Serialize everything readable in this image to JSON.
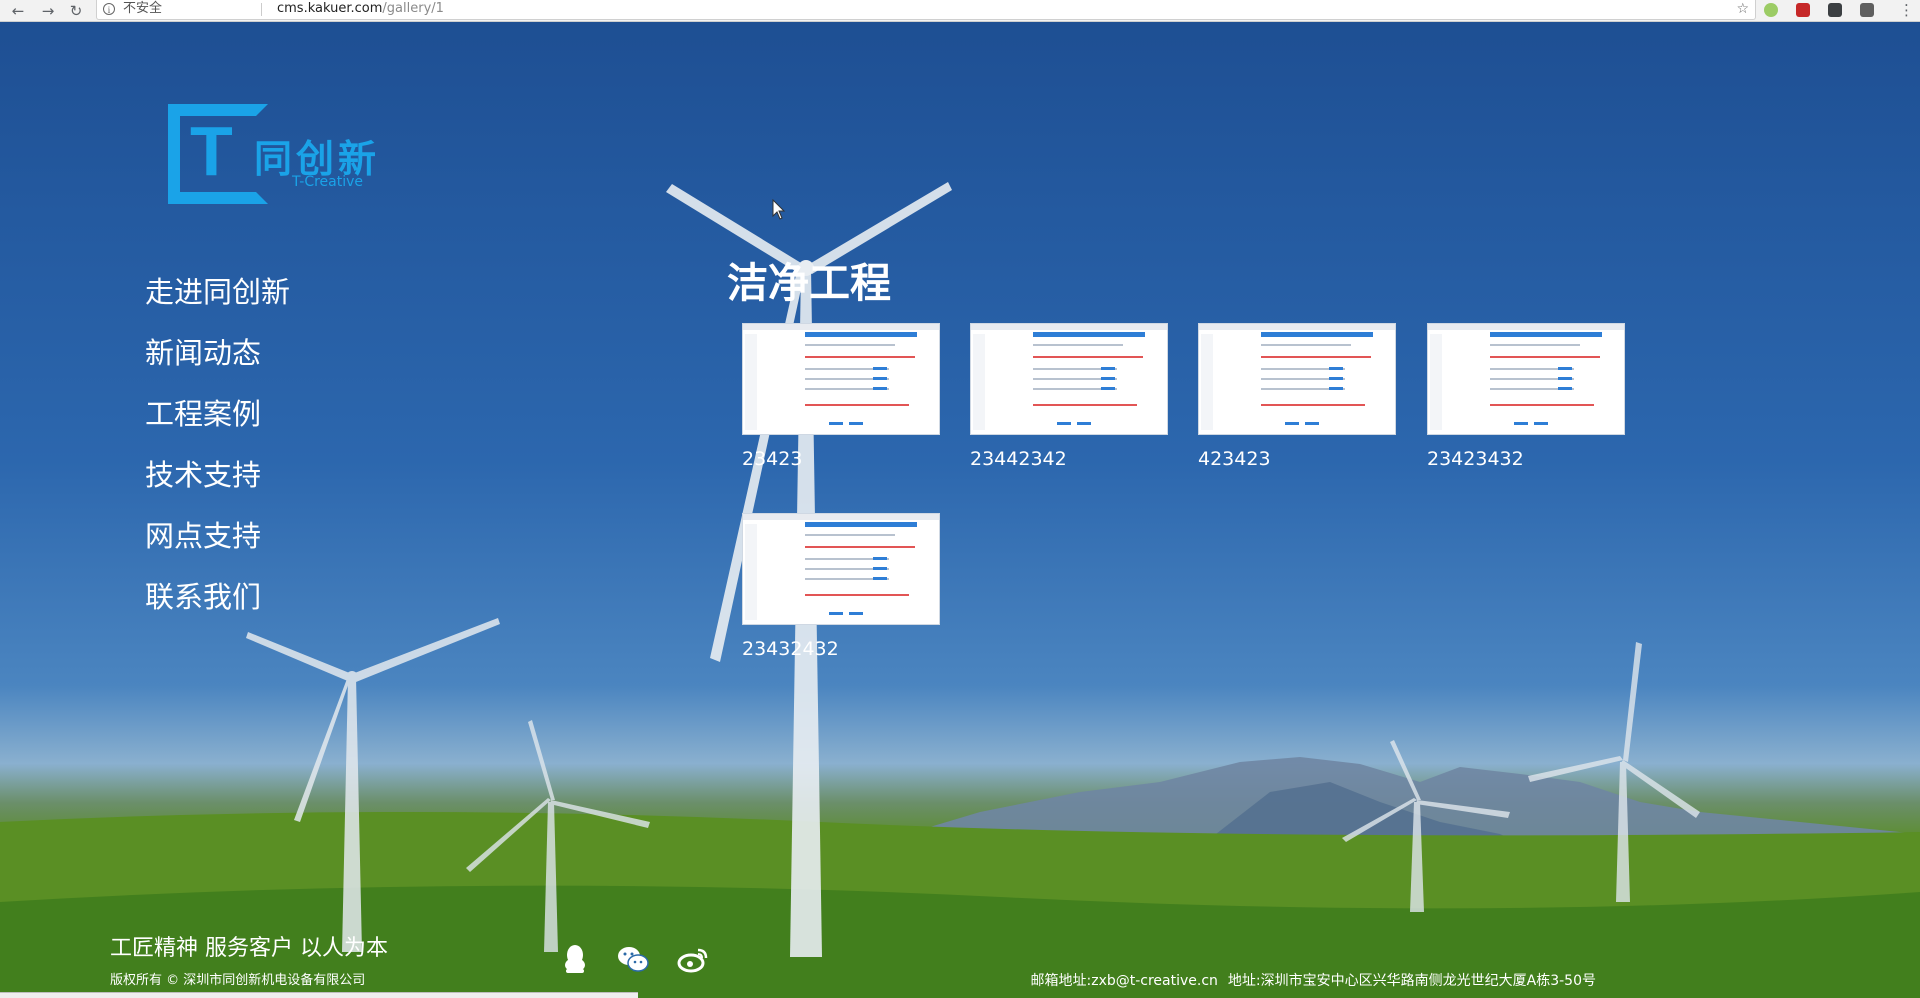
{
  "browser": {
    "security_label": "不安全",
    "url_host": "cms.kakuer.com",
    "url_path": "/gallery/1",
    "star_icon": "star-icon",
    "colors": {
      "ext_green": "#8bc34a",
      "ext_red": "#d93025",
      "ext_dark": "#3c4043"
    }
  },
  "logo": {
    "brand_cn": "同创新",
    "brand_en": "T-Creative",
    "mark_letter": "T",
    "color": "#1aa3e8"
  },
  "nav": {
    "items": [
      {
        "label": "走进同创新"
      },
      {
        "label": "新闻动态"
      },
      {
        "label": "工程案例"
      },
      {
        "label": "技术支持"
      },
      {
        "label": "网点支持"
      },
      {
        "label": "联系我们"
      }
    ]
  },
  "main": {
    "title": "洁净工程",
    "items": [
      {
        "caption": "23423"
      },
      {
        "caption": "23442342"
      },
      {
        "caption": "423423"
      },
      {
        "caption": "23423432"
      },
      {
        "caption": "23432432"
      }
    ]
  },
  "footer": {
    "slogan": "工匠精神 服务客户 以人为本",
    "copyright": "版权所有 © 深圳市同创新机电设备有限公司",
    "social": [
      {
        "icon": "qq-icon"
      },
      {
        "icon": "wechat-icon"
      },
      {
        "icon": "weibo-icon"
      }
    ],
    "email": "邮箱地址:zxb@t-creative.cn",
    "address": "地址:深圳市宝安中心区兴华路南侧龙光世纪大厦A栋3-50号"
  }
}
